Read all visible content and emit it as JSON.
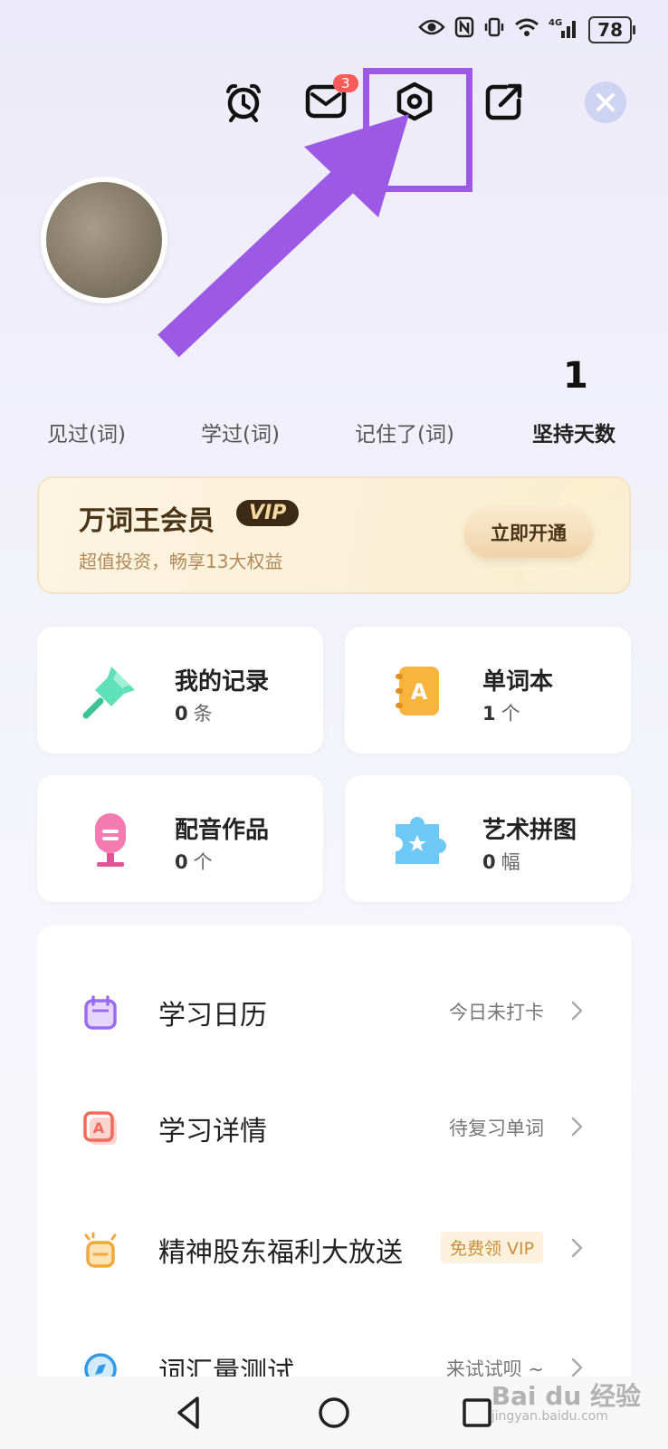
{
  "status": {
    "battery": "78",
    "network": "4G"
  },
  "topbar": {
    "mail_badge": "3"
  },
  "stats": [
    {
      "label": "见过(词)",
      "value": ""
    },
    {
      "label": "学过(词)",
      "value": ""
    },
    {
      "label": "记住了(词)",
      "value": ""
    },
    {
      "label": "坚持天数",
      "value": "1"
    }
  ],
  "vip": {
    "title": "万词王会员",
    "tag": "VIP",
    "subtitle": "超值投资，畅享13大权益",
    "button": "立即开通"
  },
  "cards": [
    {
      "title": "我的记录",
      "count": "0",
      "unit": "条"
    },
    {
      "title": "单词本",
      "count": "1",
      "unit": "个"
    },
    {
      "title": "配音作品",
      "count": "0",
      "unit": "个"
    },
    {
      "title": "艺术拼图",
      "count": "0",
      "unit": "幅"
    }
  ],
  "list": [
    {
      "title": "学习日历",
      "right": "今日未打卡"
    },
    {
      "title": "学习详情",
      "right": "待复习单词"
    },
    {
      "title": "精神股东福利大放送",
      "tag": "免费领 VIP"
    },
    {
      "title": "词汇量测试",
      "right": "来试试呗 ~"
    }
  ],
  "watermark": {
    "main": "Bai du 经验",
    "sub": "jingyan.baidu.com"
  },
  "colors": {
    "highlight": "#9b59e6",
    "badge": "#ff5a5a",
    "vip_bg": "#fbf0d6"
  }
}
